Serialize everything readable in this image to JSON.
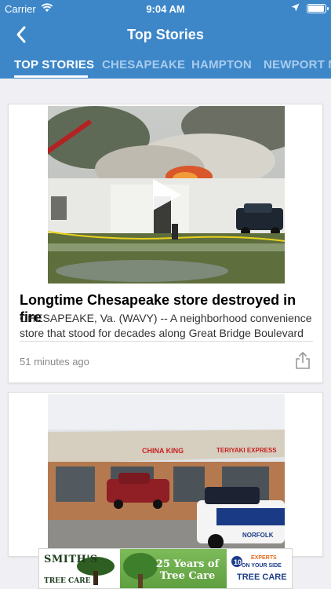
{
  "status_bar": {
    "carrier": "Carrier",
    "time": "9:04 AM"
  },
  "nav": {
    "title": "Top Stories"
  },
  "tabs": [
    {
      "label": "TOP STORIES",
      "active": true
    },
    {
      "label": "CHESAPEAKE",
      "active": false
    },
    {
      "label": "HAMPTON",
      "active": false
    },
    {
      "label": "NEWPORT N",
      "active": false
    }
  ],
  "articles": [
    {
      "headline": "Longtime Chesapeake store destroyed in fire",
      "summary": "CHESAPEAKE, Va. (WAVY) -- A neighborhood convenience store that stood for decades along Great Bridge Boulevard",
      "timestamp": "51 minutes ago",
      "has_video": true
    },
    {
      "photo_signs": [
        "CHINA KING",
        "TERIYAKI EXPRESS"
      ],
      "vehicle_text": "NORFOLK"
    }
  ],
  "ad": {
    "brand": "SMITH'S",
    "brand_sub": "TREE CARE",
    "headline_line1": "25 Years of",
    "headline_line2": "Tree Care",
    "right_line1": "EXPERTS",
    "right_line2": "ON YOUR SIDE",
    "right_line3": "TREE CARE"
  },
  "colors": {
    "brand_blue": "#3d87c9",
    "tab_inactive": "#a9ccec"
  }
}
